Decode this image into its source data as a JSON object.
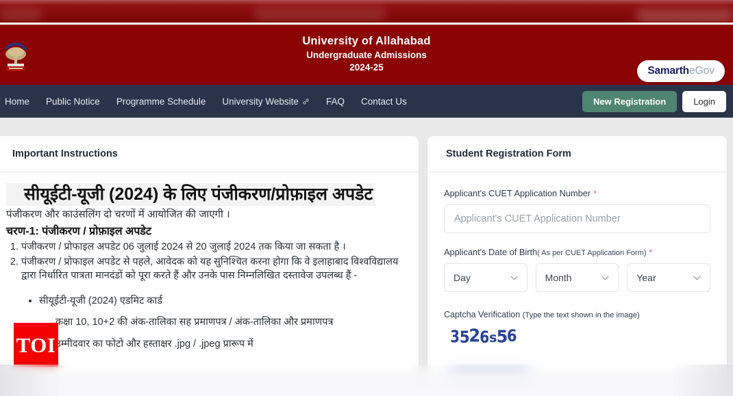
{
  "header": {
    "title": "University of Allahabad",
    "subtitle": "Undergraduate Admissions",
    "session": "2024-25",
    "emblem_icon": "university-emblem-icon",
    "brand": {
      "primary": "Samarth",
      "secondary": "eGov"
    },
    "colors": {
      "maroon": "#8b0303",
      "navy": "#29334a",
      "green": "#4f8570",
      "page_bg": "#e9e9e9"
    }
  },
  "nav": {
    "items": [
      {
        "label": "Home",
        "external": false
      },
      {
        "label": "Public Notice",
        "external": false
      },
      {
        "label": "Programme Schedule",
        "external": false
      },
      {
        "label": "University Website",
        "external": true,
        "icon": "external-link-icon"
      },
      {
        "label": "FAQ",
        "external": false
      },
      {
        "label": "Contact Us",
        "external": false
      }
    ],
    "new_registration_label": "New Registration",
    "login_label": "Login"
  },
  "instructions": {
    "panel_title": "Important Instructions",
    "heading": "सीयूईटी-यूजी (2024) के लिए पंजीकरण/प्रोफ़ाइल अपडेट",
    "subheading": "पंजीकरण और काउंसलिंग दो चरणों में आयोजित की जाएगी ।",
    "phase_title": "चरण-1: पंजीकरण / प्रोफ़ाइल अपडेट",
    "list": [
      "पंजीकरण / प्रोफाइल अपडेट 06 जुलाई 2024 से 20 जुलाई 2024 तक किया जा सकता है ।",
      "पंजीकरण / प्रोफाइल अपडेट से पहले, आवेदक को यह सुनिश्चित करना होगा कि वे इलाहाबाद विश्वविद्यालय द्वारा निर्धारित पात्रता मानदंडों को पूरा करते हैं और उनके पास निम्नलिखित दस्तावेज उपलब्ध हैं -"
    ],
    "documents": [
      "सीयूईटी-यूजी (2024) एडमिट कार्ड",
      "कक्षा 10, 10+2 की अंक-तालिका सह प्रमाणपत्र / अंक-तालिका और प्रमाणपत्र",
      "उम्मीदवार का फोटो और हस्ताक्षर .jpg / .jpeg प्रारूप में"
    ]
  },
  "form": {
    "panel_title": "Student Registration Form",
    "application_number": {
      "label": "Applicant's CUET Application Number",
      "required": "*",
      "placeholder": "Applicant's CUET Application Number",
      "value": ""
    },
    "date_of_birth": {
      "label": "Applicant's Date of Birth",
      "label_sub": "( As per CUET Application Form)",
      "required": "*",
      "day": "Day",
      "month": "Month",
      "year": "Year",
      "chevron_icon": "chevron-down-icon"
    },
    "captcha": {
      "label": "Captcha Verification",
      "label_sub": "(Type the text shown in the image)",
      "image_text": "3526s56"
    }
  },
  "watermark": {
    "label": "TOI"
  }
}
